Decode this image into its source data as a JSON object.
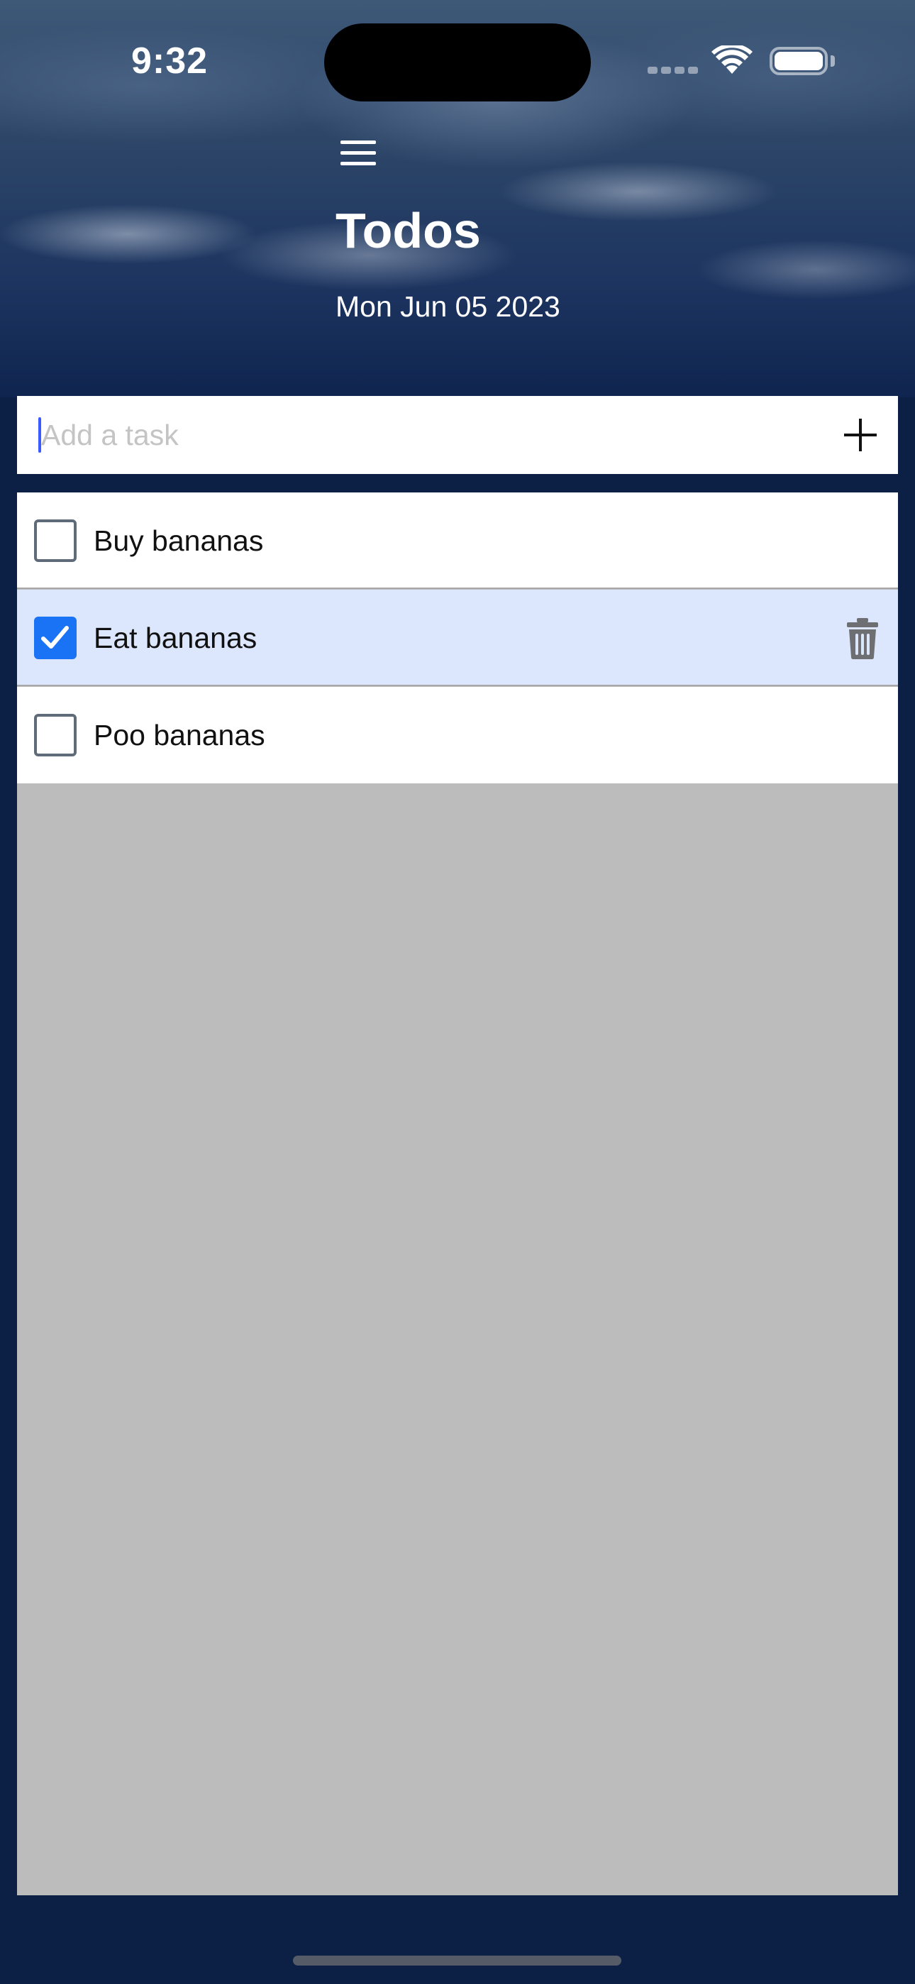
{
  "status_bar": {
    "time": "9:32"
  },
  "header": {
    "title": "Todos",
    "date": "Mon Jun 05 2023",
    "menu_icon": "hamburger-menu-icon"
  },
  "add_task": {
    "placeholder": "Add a task",
    "value": "",
    "add_icon": "plus-icon"
  },
  "tasks": [
    {
      "label": "Buy bananas",
      "checked": false
    },
    {
      "label": "Eat bananas",
      "checked": true,
      "delete_icon": "trash-icon"
    },
    {
      "label": "Poo bananas",
      "checked": false
    }
  ],
  "colors": {
    "checked_accent": "#1a72f5",
    "selected_row": "#dce6fd",
    "list_background": "#bcbcbc",
    "page_background": "#0c1f45"
  }
}
